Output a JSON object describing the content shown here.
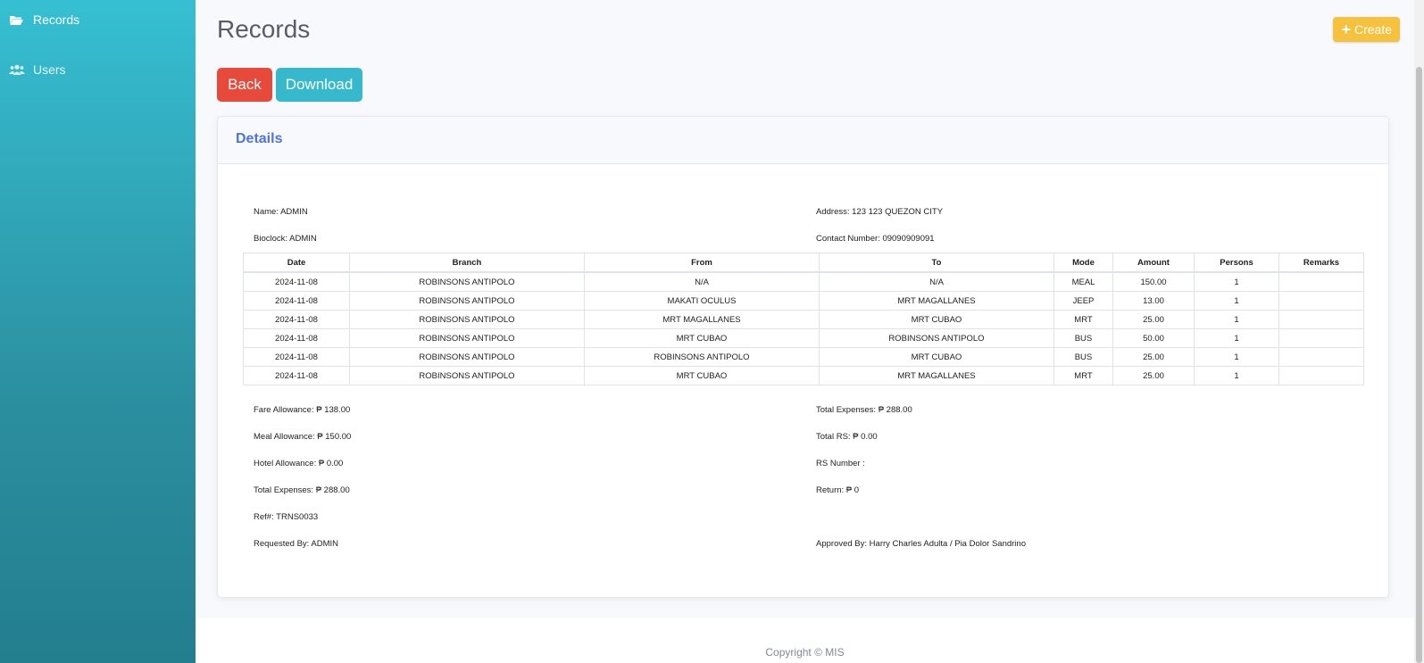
{
  "sidebar": {
    "items": [
      {
        "label": "Records",
        "icon": "folder-open-icon"
      },
      {
        "label": "Users",
        "icon": "users-icon"
      }
    ]
  },
  "page": {
    "title": "Records",
    "create_label": "Create",
    "back_label": "Back",
    "download_label": "Download"
  },
  "card": {
    "title": "Details",
    "name": "Name: ADMIN",
    "address": "Address: 123 123 QUEZON CITY",
    "bioclock": "Bioclock: ADMIN",
    "contact": "Contact Number: 09090909091",
    "fare_allowance": "Fare Allowance: ₱ 138.00",
    "total_expenses_right": "Total Expenses: ₱ 288.00",
    "meal_allowance": "Meal Allowance: ₱ 150.00",
    "total_rs": "Total RS: ₱ 0.00",
    "hotel_allowance": "Hotel Allowance: ₱ 0.00",
    "rs_number": "RS Number :",
    "total_expenses_left": "Total Expenses: ₱ 288.00",
    "return": "Return: ₱ 0",
    "ref": "Ref#: TRNS0033",
    "requested_by": "Requested By: ADMIN",
    "approved_by": "Approved By: Harry Charles Adulta / Pia Dolor Sandrino"
  },
  "table": {
    "headers": [
      "Date",
      "Branch",
      "From",
      "To",
      "Mode",
      "Amount",
      "Persons",
      "Remarks"
    ],
    "rows": [
      [
        "2024-11-08",
        "ROBINSONS ANTIPOLO",
        "N/A",
        "N/A",
        "MEAL",
        "150.00",
        "1",
        ""
      ],
      [
        "2024-11-08",
        "ROBINSONS ANTIPOLO",
        "MAKATI OCULUS",
        "MRT MAGALLANES",
        "JEEP",
        "13.00",
        "1",
        ""
      ],
      [
        "2024-11-08",
        "ROBINSONS ANTIPOLO",
        "MRT MAGALLANES",
        "MRT CUBAO",
        "MRT",
        "25.00",
        "1",
        ""
      ],
      [
        "2024-11-08",
        "ROBINSONS ANTIPOLO",
        "MRT CUBAO",
        "ROBINSONS ANTIPOLO",
        "BUS",
        "50.00",
        "1",
        ""
      ],
      [
        "2024-11-08",
        "ROBINSONS ANTIPOLO",
        "ROBINSONS ANTIPOLO",
        "MRT CUBAO",
        "BUS",
        "25.00",
        "1",
        ""
      ],
      [
        "2024-11-08",
        "ROBINSONS ANTIPOLO",
        "MRT CUBAO",
        "MRT MAGALLANES",
        "MRT",
        "25.00",
        "1",
        ""
      ]
    ]
  },
  "footer": {
    "copyright": "Copyright © MIS"
  },
  "colors": {
    "sidebar_top": "#36bfd2",
    "sidebar_bottom": "#237e8e",
    "create_button": "#f6c23e",
    "back_button": "#e74a3b",
    "download_button": "#36b9cc",
    "card_title": "#4e73df"
  }
}
